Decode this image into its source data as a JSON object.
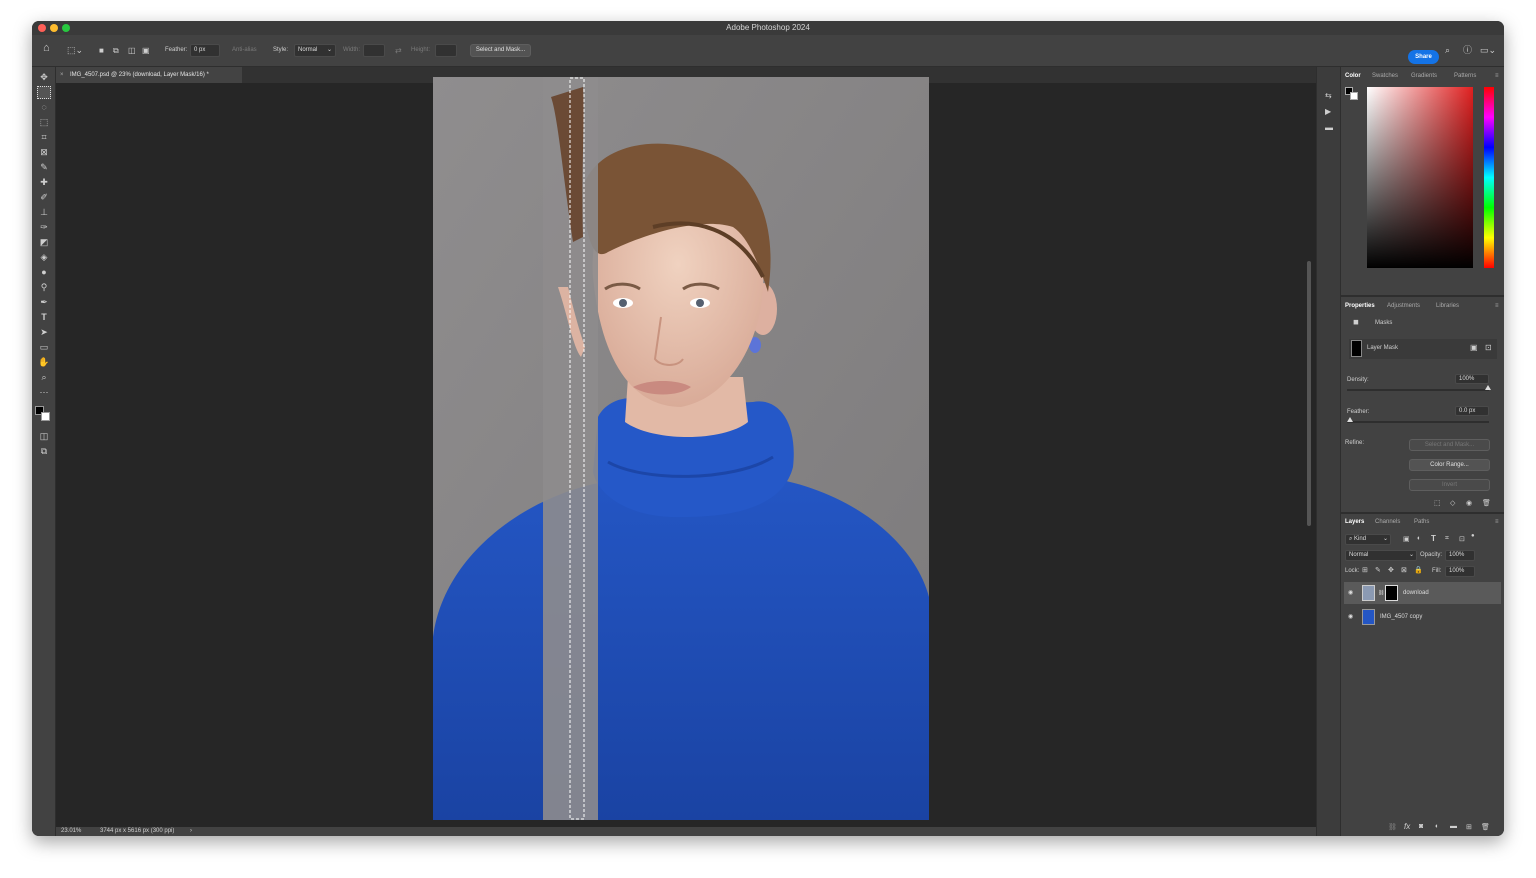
{
  "app": {
    "title": "Adobe Photoshop 2024",
    "colors": {
      "accent": "#1473e6",
      "panel": "#424242",
      "canvas": "#262626",
      "sweater": "#1f4fb8"
    }
  },
  "options": {
    "feather_label": "Feather:",
    "feather_value": "0 px",
    "anti_alias": "Anti-alias",
    "style_label": "Style:",
    "style_value": "Normal",
    "width_label": "Width:",
    "height_label": "Height:",
    "select_mask": "Select and Mask...",
    "share": "Share"
  },
  "document": {
    "tab": "IMG_4507.psd @ 23% (download, Layer Mask/16) *",
    "zoom": "23.01%",
    "info": "3744 px x 5616 px (300 ppi)"
  },
  "color_panel": {
    "tabs": [
      "Color",
      "Swatches",
      "Gradients",
      "Patterns"
    ],
    "fg": "#000000",
    "bg": "#ffffff",
    "hue": "#e02020"
  },
  "properties": {
    "tabs": [
      "Properties",
      "Adjustments",
      "Libraries"
    ],
    "masks_label": "Masks",
    "layer_mask": "Layer Mask",
    "density_label": "Density:",
    "density_value": "100%",
    "feather_label": "Feather:",
    "feather_value": "0.0 px",
    "refine_label": "Refine:",
    "select_mask": "Select and Mask...",
    "color_range": "Color Range...",
    "invert": "Invert"
  },
  "layers": {
    "tabs": [
      "Layers",
      "Channels",
      "Paths"
    ],
    "kind": "Kind",
    "blend": "Normal",
    "opacity_label": "Opacity:",
    "opacity_value": "100%",
    "lock_label": "Lock:",
    "fill_label": "Fill:",
    "fill_value": "100%",
    "items": [
      {
        "name": "download"
      },
      {
        "name": "IMG_4507 copy"
      }
    ]
  }
}
